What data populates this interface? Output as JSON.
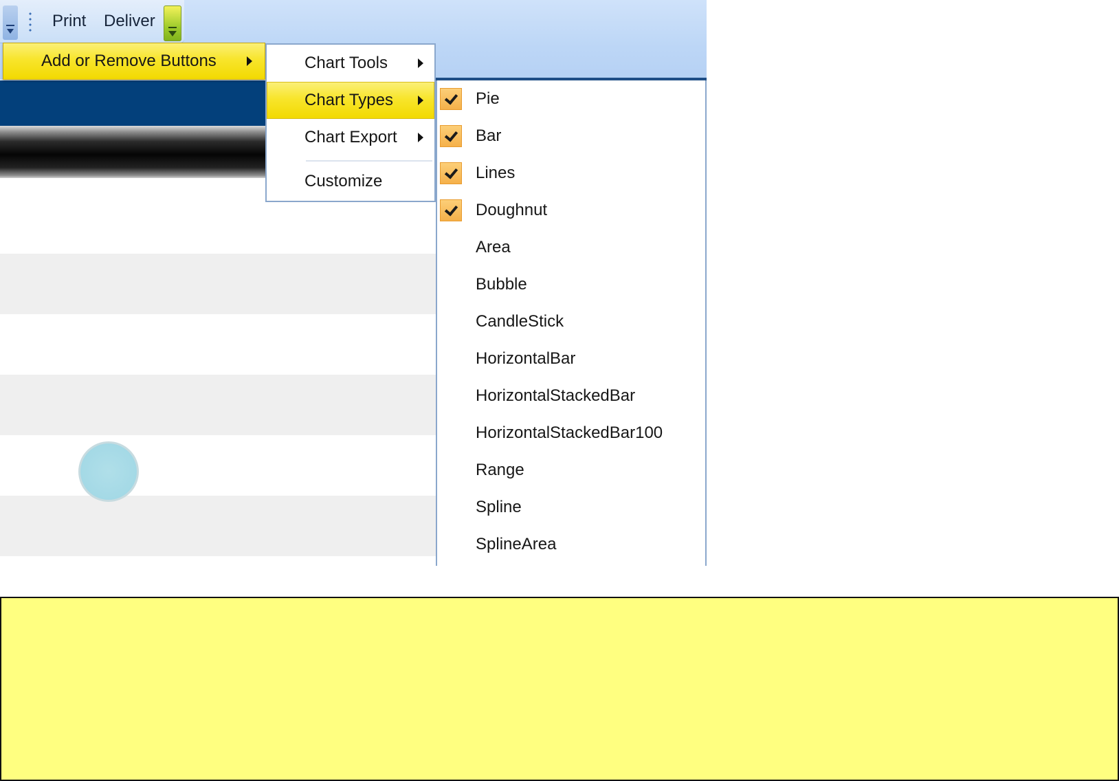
{
  "quick_access_toolbar": {
    "print_label": "Print",
    "deliver_label": "Deliver"
  },
  "context_menu": {
    "root_item": "Add or Remove Buttons",
    "level2_items": [
      "Chart Tools",
      "Chart Types",
      "Chart Export",
      "Customize"
    ],
    "chart_types": [
      {
        "label": "Pie",
        "checked": true
      },
      {
        "label": "Bar",
        "checked": true
      },
      {
        "label": "Lines",
        "checked": true
      },
      {
        "label": "Doughnut",
        "checked": true
      },
      {
        "label": "Area",
        "checked": false
      },
      {
        "label": "Bubble",
        "checked": false
      },
      {
        "label": "CandleStick",
        "checked": false
      },
      {
        "label": "HorizontalBar",
        "checked": false
      },
      {
        "label": "HorizontalStackedBar",
        "checked": false
      },
      {
        "label": "HorizontalStackedBar100",
        "checked": false
      },
      {
        "label": "Range",
        "checked": false
      },
      {
        "label": "Spline",
        "checked": false
      },
      {
        "label": "SplineArea",
        "checked": false
      }
    ]
  },
  "colors": {
    "highlight": "#f8e52c",
    "check_background": "#f5b14a",
    "menu_border": "#8aa7cc",
    "toolbar_band": "#bcd6f6",
    "dark_band": "#03407b",
    "note_background": "#ffff80",
    "bubble": "#a4d9e6"
  },
  "icons": {
    "toolbar_customize": "chevron-down-icon",
    "overflow": "chevron-down-icon",
    "grip": "grip-icon",
    "submenu": "triangle-right-icon",
    "check": "checkmark-icon"
  }
}
